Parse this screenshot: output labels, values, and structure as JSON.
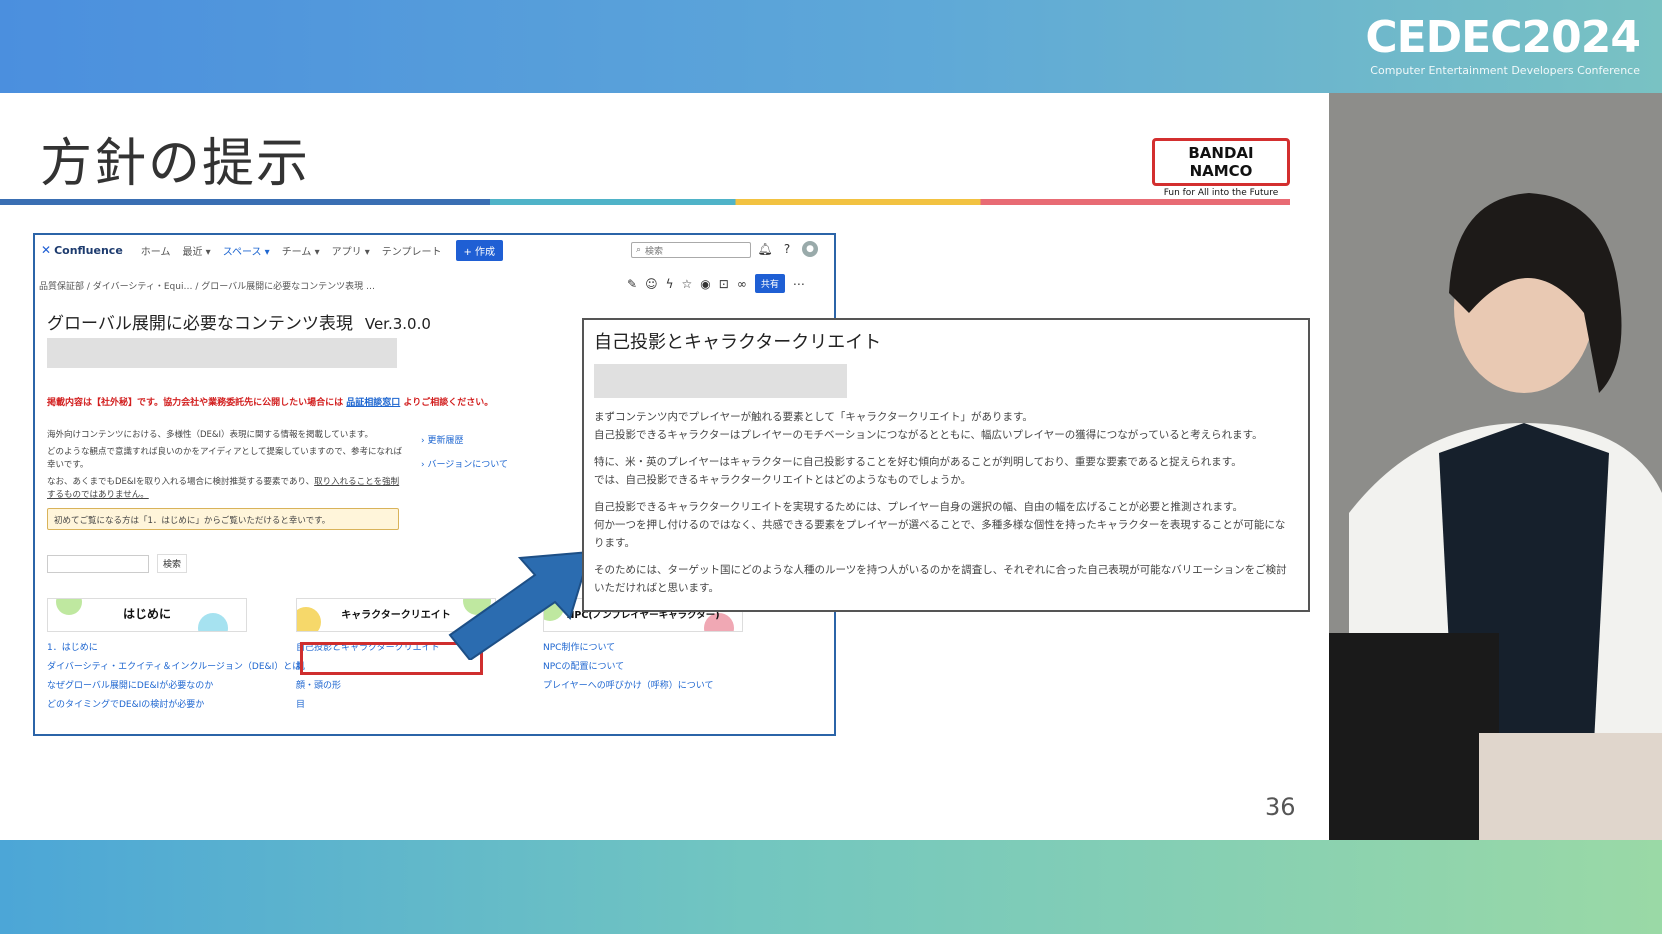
{
  "event": {
    "logo": "CEDEC2024",
    "subtitle": "Computer Entertainment Developers Conference"
  },
  "slide": {
    "title": "方針の提示",
    "brand": "BANDAI NAMCO",
    "brand_tagline": "Fun for All into the Future",
    "page_number": "36"
  },
  "confluence": {
    "app_name": "Confluence",
    "nav": [
      "ホーム",
      "最近 ▾",
      "スペース ▾",
      "チーム ▾",
      "アプリ ▾",
      "テンプレート"
    ],
    "create_label": "+ 作成",
    "search_placeholder": "検索",
    "breadcrumb": "品質保証部 / ダイバーシティ・Equi… / グローバル展開に必要なコンテンツ表現 …",
    "share_label": "共有",
    "page_title": "グローバル展開に必要なコンテンツ表現",
    "version": "Ver.3.0.0",
    "notice_red": "掲載内容は【社外秘】です。協力会社や業務委託先に公開したい場合には",
    "notice_link": "品証相談窓口",
    "notice_tail": "よりご相談ください。",
    "intro_1": "海外向けコンテンツにおける、多様性（DE&I）表現に関する情報を掲載しています。",
    "intro_2": "どのような観点で意識すれば良いのかをアイディアとして提案していますので、参考になれば幸いです。",
    "intro_3a": "なお、あくまでもDE&Iを取り入れる場合に検討推奨する要素であり、",
    "intro_3b": "取り入れることを強制するものではありません。",
    "side_links": [
      "› 更新履歴",
      "› バージョンについて"
    ],
    "yellow_note": "初めてご覧になる方は「1．はじめに」からご覧いただけると幸いです。",
    "search_button": "検索",
    "banners": [
      "はじめに",
      "キャラクタークリエイト",
      "NPC(ノンプレイヤーキャラクター)"
    ],
    "col1_links": [
      "1．はじめに",
      "ダイバーシティ・エクイティ＆インクルージョン（DE&I）とは",
      "なぜグローバル展開にDE&Iが必要なのか",
      "どのタイミングでDE&Iの検討が必要か"
    ],
    "col2_links": [
      "自己投影とキャラクタークリエイト",
      "肌",
      "顔・頭の形",
      "目"
    ],
    "col3_links": [
      "NPC制作について",
      "NPCの配置について",
      "プレイヤーへの呼びかけ（呼称）について"
    ]
  },
  "popup": {
    "title": "自己投影とキャラクタークリエイト",
    "paragraphs": [
      [
        "まずコンテンツ内でプレイヤーが触れる要素として「キャラクタークリエイト」があります。",
        "自己投影できるキャラクターはプレイヤーのモチベーションにつながるとともに、幅広いプレイヤーの獲得につながっていると考えられます。"
      ],
      [
        "特に、米・英のプレイヤーはキャラクターに自己投影することを好む傾向があることが判明しており、重要な要素であると捉えられます。",
        "では、自己投影できるキャラクタークリエイトとはどのようなものでしょうか。"
      ],
      [
        "自己投影できるキャラクタークリエイトを実現するためには、プレイヤー自身の選択の幅、自由の幅を広げることが必要と推測されます。",
        "何か一つを押し付けるのではなく、共感できる要素をプレイヤーが選べることで、多種多様な個性を持ったキャラクターを表現することが可能になります。"
      ],
      [
        "そのためには、ターゲット国にどのような人種のルーツを持つ人がいるのかを調査し、それぞれに合った自己表現が可能なバリエーションをご検討いただければと思います。"
      ]
    ]
  },
  "colors": {
    "accent_blue": "#1f5fd4",
    "highlight_red": "#cf2e2e",
    "arrow_blue": "#2b6cb0"
  }
}
